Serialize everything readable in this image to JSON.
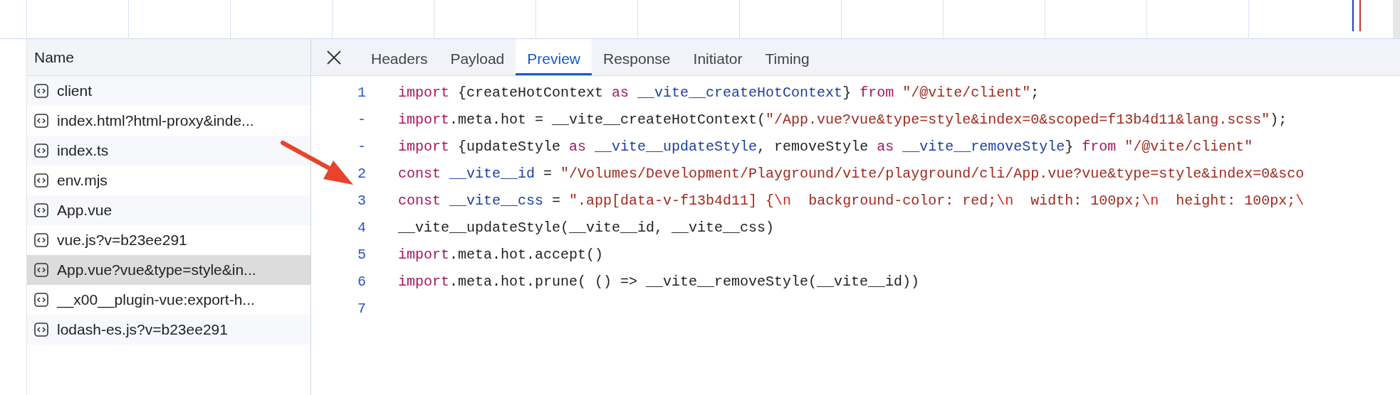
{
  "requests": {
    "column": "Name",
    "items": [
      {
        "name": "client",
        "selected": false
      },
      {
        "name": "index.html?html-proxy&inde...",
        "selected": false
      },
      {
        "name": "index.ts",
        "selected": false
      },
      {
        "name": "env.mjs",
        "selected": false
      },
      {
        "name": "App.vue",
        "selected": false
      },
      {
        "name": "vue.js?v=b23ee291",
        "selected": false
      },
      {
        "name": "App.vue?vue&type=style&in...",
        "selected": true
      },
      {
        "name": "__x00__plugin-vue:export-h...",
        "selected": false
      },
      {
        "name": "lodash-es.js?v=b23ee291",
        "selected": false
      }
    ]
  },
  "detail": {
    "tabs": [
      {
        "label": "Headers",
        "selected": false
      },
      {
        "label": "Payload",
        "selected": false
      },
      {
        "label": "Preview",
        "selected": true
      },
      {
        "label": "Response",
        "selected": false
      },
      {
        "label": "Initiator",
        "selected": false
      },
      {
        "label": "Timing",
        "selected": false
      }
    ],
    "code": [
      {
        "number": "1",
        "tokens": [
          {
            "kind": "keyword",
            "text": "import"
          },
          {
            "kind": "plain",
            "text": " {createHotContext "
          },
          {
            "kind": "keyword",
            "text": "as "
          },
          {
            "kind": "variable",
            "text": "__vite__createHotContext"
          },
          {
            "kind": "plain",
            "text": "} "
          },
          {
            "kind": "keyword",
            "text": "from "
          },
          {
            "kind": "string",
            "text": "\"/@vite/client\""
          },
          {
            "kind": "plain",
            "text": ";"
          }
        ]
      },
      {
        "number": "-",
        "tokens": [
          {
            "kind": "keyword",
            "text": "import"
          },
          {
            "kind": "plain",
            "text": ".meta.hot = __vite__createHotContext("
          },
          {
            "kind": "string",
            "text": "\"/App.vue?vue&type=style&index=0&scoped=f13b4d11&lang.scss\""
          },
          {
            "kind": "plain",
            "text": ");"
          }
        ]
      },
      {
        "number": "-",
        "tokens": [
          {
            "kind": "keyword",
            "text": "import"
          },
          {
            "kind": "plain",
            "text": " {updateStyle "
          },
          {
            "kind": "keyword",
            "text": "as "
          },
          {
            "kind": "variable",
            "text": "__vite__updateStyle"
          },
          {
            "kind": "plain",
            "text": ", removeStyle "
          },
          {
            "kind": "keyword",
            "text": "as "
          },
          {
            "kind": "variable",
            "text": "__vite__removeStyle"
          },
          {
            "kind": "plain",
            "text": "} "
          },
          {
            "kind": "keyword",
            "text": "from "
          },
          {
            "kind": "string",
            "text": "\"/@vite/client\""
          }
        ]
      },
      {
        "number": "2",
        "tokens": [
          {
            "kind": "keyword",
            "text": "const "
          },
          {
            "kind": "variable",
            "text": "__vite__id"
          },
          {
            "kind": "plain",
            "text": " = "
          },
          {
            "kind": "string",
            "text": "\"/Volumes/Development/Playground/vite/playground/cli/App.vue?vue&type=style&index=0&sco"
          }
        ]
      },
      {
        "number": "3",
        "tokens": [
          {
            "kind": "keyword",
            "text": "const "
          },
          {
            "kind": "variable",
            "text": "__vite__css"
          },
          {
            "kind": "plain",
            "text": " = "
          },
          {
            "kind": "string",
            "text": "\".app[data-v-f13b4d11] {"
          },
          {
            "kind": "escape",
            "text": "\\n"
          },
          {
            "kind": "string",
            "text": "  background-color: red;"
          },
          {
            "kind": "escape",
            "text": "\\n"
          },
          {
            "kind": "string",
            "text": "  width: 100px;"
          },
          {
            "kind": "escape",
            "text": "\\n"
          },
          {
            "kind": "string",
            "text": "  height: 100px;"
          },
          {
            "kind": "escape",
            "text": "\\"
          }
        ]
      },
      {
        "number": "4",
        "tokens": [
          {
            "kind": "plain",
            "text": "__vite__updateStyle(__vite__id, __vite__css)"
          }
        ]
      },
      {
        "number": "5",
        "tokens": [
          {
            "kind": "keyword",
            "text": "import"
          },
          {
            "kind": "plain",
            "text": ".meta.hot.accept()"
          }
        ]
      },
      {
        "number": "6",
        "tokens": [
          {
            "kind": "keyword",
            "text": "import"
          },
          {
            "kind": "plain",
            "text": ".meta.hot.prune( () => __vite__removeStyle(__vite__id))"
          }
        ]
      },
      {
        "number": "7"
      }
    ]
  }
}
